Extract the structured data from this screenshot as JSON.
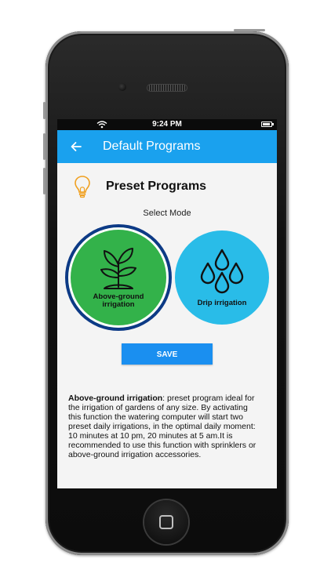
{
  "status_bar": {
    "time": "9:24 PM"
  },
  "app_bar": {
    "title": "Default Programs"
  },
  "section": {
    "title": "Preset Programs",
    "icon": "lightbulb-icon"
  },
  "select_mode_label": "Select Mode",
  "modes": [
    {
      "label_line1": "Above-ground",
      "label_line2": "irrigation",
      "icon": "plant-icon",
      "color": "#33b24a",
      "selected": true
    },
    {
      "label_line1": "Drip irrigation",
      "label_line2": "",
      "icon": "water-drops-icon",
      "color": "#29bce8",
      "selected": false
    }
  ],
  "save_label": "SAVE",
  "description": {
    "title": "Above-ground irrigation",
    "body": ": preset program ideal for the irrigation of gardens of any size. By activating this function the watering computer will start two preset daily irrigations, in the optimal daily moment: 10 minutes at 10 pm, 20 minutes at 5 am.It is recommended to use this function with sprinklers or above-ground irrigation accessories."
  },
  "colors": {
    "app_bar": "#1aa1ee",
    "save_button": "#1a8ff0",
    "selected_ring": "#0d3a86",
    "bulb": "#f0a020"
  }
}
